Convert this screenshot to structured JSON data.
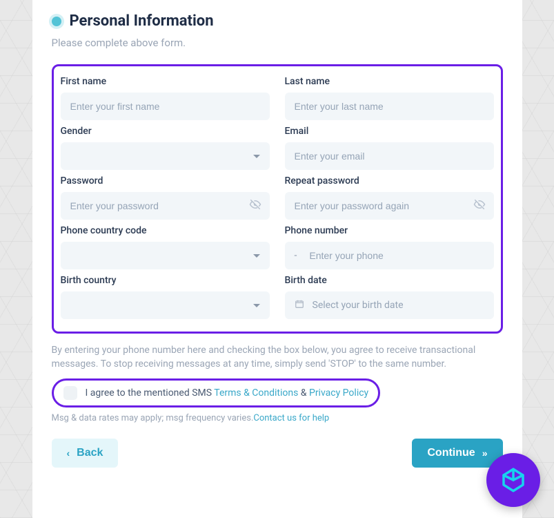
{
  "section": {
    "title": "Personal Information",
    "subtitle": "Please complete above form."
  },
  "fields": {
    "first_name": {
      "label": "First name",
      "placeholder": "Enter your first name"
    },
    "last_name": {
      "label": "Last name",
      "placeholder": "Enter your last name"
    },
    "gender": {
      "label": "Gender"
    },
    "email": {
      "label": "Email",
      "placeholder": "Enter your email"
    },
    "password": {
      "label": "Password",
      "placeholder": "Enter your password"
    },
    "repeat_password": {
      "label": "Repeat password",
      "placeholder": "Enter your password again"
    },
    "phone_code": {
      "label": "Phone country code"
    },
    "phone_number": {
      "label": "Phone number",
      "prefix": "-",
      "placeholder": "Enter your phone"
    },
    "birth_country": {
      "label": "Birth country"
    },
    "birth_date": {
      "label": "Birth date",
      "placeholder": "Select your birth date"
    }
  },
  "disclaimer": "By entering your phone number here and checking the box below, you agree to receive transactional messages. To stop receiving messages at any time, simply send 'STOP' to the same number.",
  "agree": {
    "prefix": "I agree to the mentioned SMS ",
    "terms": "Terms & Conditions",
    "sep": " & ",
    "privacy": "Privacy Policy"
  },
  "fineprint": {
    "text": "Msg & data rates may apply; msg frequency varies.",
    "contact": "Contact us for help"
  },
  "buttons": {
    "back": "Back",
    "continue": "Continue"
  }
}
